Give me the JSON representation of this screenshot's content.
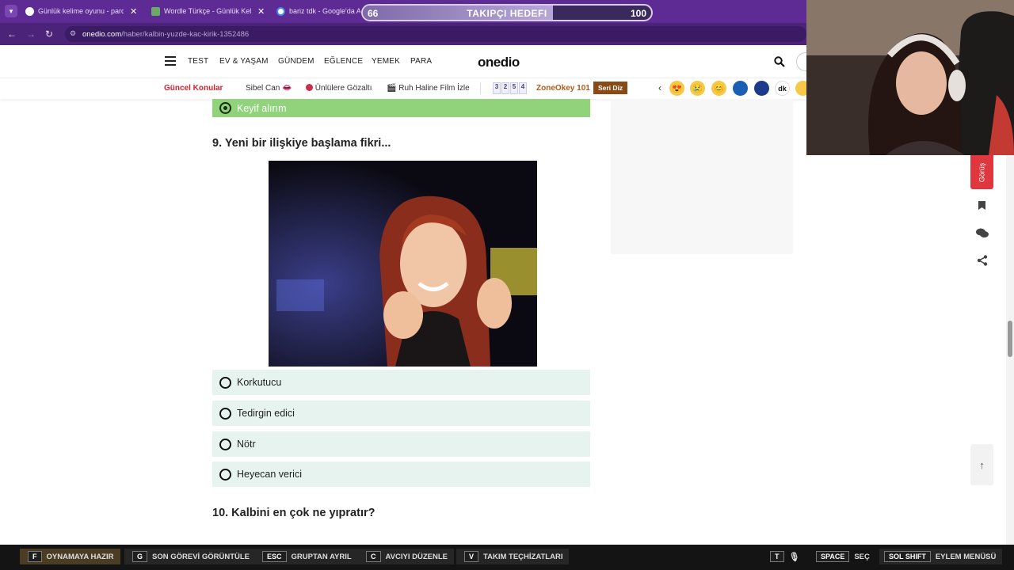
{
  "browser": {
    "tabs": [
      {
        "title": "Günlük kelime oyunu - parolla",
        "favicon_color": "#ffffff"
      },
      {
        "title": "Wordle Türkçe - Günlük Kelime",
        "favicon_color": "#6aaa64"
      },
      {
        "title": "bariz tdk - Google'da Ara",
        "favicon_color": "#4285f4"
      }
    ],
    "url_host": "onedio.com",
    "url_path": "/haber/kalbin-yuzde-kac-kirik-1352486"
  },
  "overlay": {
    "goal_current": "66",
    "goal_title": "TAKIPÇI HEDEFI",
    "goal_target": "100",
    "goal_progress": 0.66
  },
  "site": {
    "logo": "onedio",
    "nav": [
      "TEST",
      "EV & YAŞAM",
      "GÜNDEM",
      "EĞLENCE",
      "YEMEK",
      "PARA"
    ],
    "topics_label": "Güncel Konular",
    "topics": [
      "Sibel Can",
      "Ünlülere Gözaltı",
      "Ruh Haline Film İzle"
    ],
    "zone_label": "ZoneOkey 101",
    "zone_button": "Seri Diz",
    "tiles": [
      "3",
      "2",
      "5",
      "4"
    ]
  },
  "quiz": {
    "prev_selected_option": "Keyif alırım",
    "question9": "9. Yeni bir ilişkiye başlama fikri...",
    "options": [
      "Korkutucu",
      "Tedirgin edici",
      "Nötr",
      "Heyecan verici"
    ],
    "question10": "10. Kalbini en çok ne yıpratır?"
  },
  "side_rail": {
    "feedback_label": "Görüş"
  },
  "hud": [
    {
      "key": "F",
      "label": "OYNAMAYA HAZIR"
    },
    {
      "key": "G",
      "label": "SON GÖREVİ GÖRÜNTÜLE"
    },
    {
      "key": "ESC",
      "label": "GRUPTAN AYRIL"
    },
    {
      "key": "C",
      "label": "AVCIYI DÜZENLE"
    },
    {
      "key": "V",
      "label": "TAKIM TEÇHİZATLARI"
    },
    {
      "key": "T",
      "label": ""
    },
    {
      "key": "SPACE",
      "label": "SEÇ"
    },
    {
      "key": "SOL SHIFT",
      "label": "EYLEM MENÜSÜ"
    }
  ]
}
